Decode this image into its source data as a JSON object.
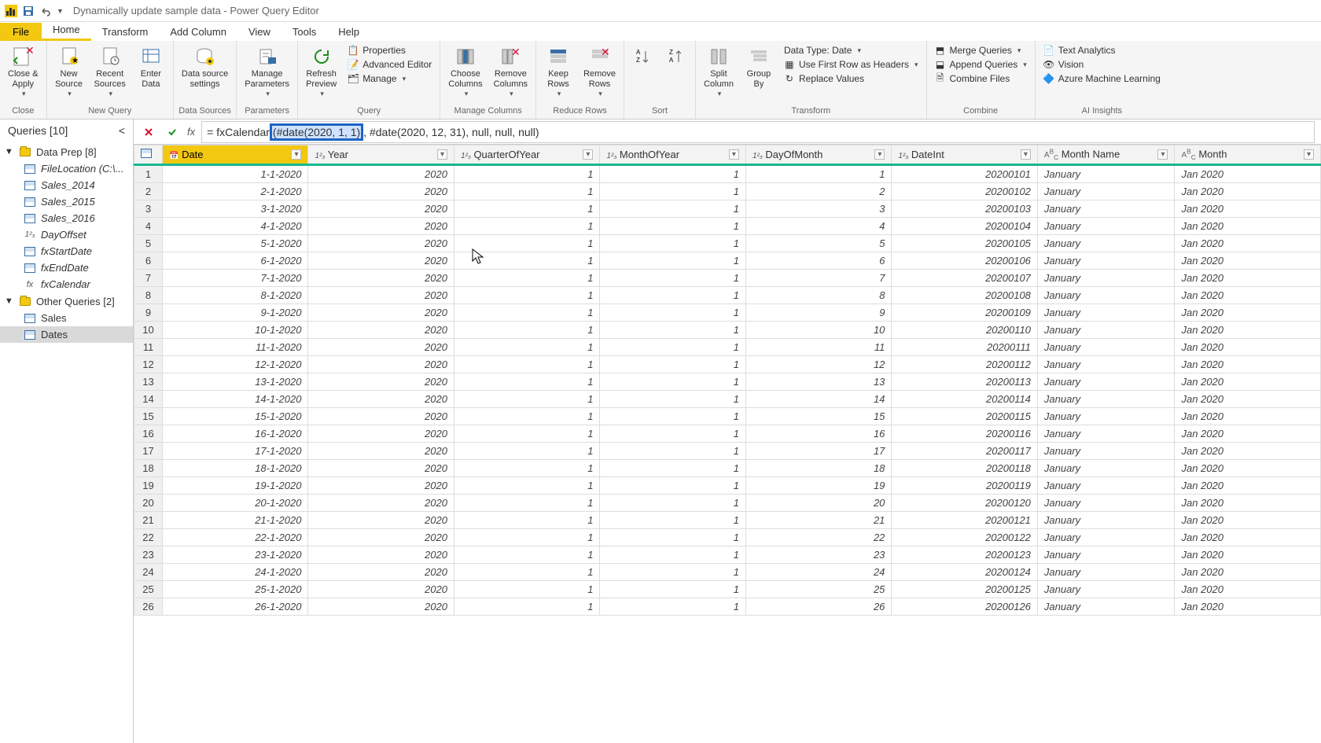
{
  "title": "Dynamically update sample data - Power Query Editor",
  "menu": {
    "file": "File",
    "home": "Home",
    "transform": "Transform",
    "addcol": "Add Column",
    "view": "View",
    "tools": "Tools",
    "help": "Help"
  },
  "ribbon": {
    "close": {
      "closeapply": "Close &\nApply",
      "group": "Close"
    },
    "newquery": {
      "newsource": "New\nSource",
      "recentsources": "Recent\nSources",
      "enterdata": "Enter\nData",
      "group": "New Query"
    },
    "datasources": {
      "dsettings": "Data source\nsettings",
      "group": "Data Sources"
    },
    "parameters": {
      "manageparams": "Manage\nParameters",
      "group": "Parameters"
    },
    "query": {
      "refresh": "Refresh\nPreview",
      "properties": "Properties",
      "adveditor": "Advanced Editor",
      "manage": "Manage",
      "group": "Query"
    },
    "managecols": {
      "choose": "Choose\nColumns",
      "remove": "Remove\nColumns",
      "group": "Manage Columns"
    },
    "reducerows": {
      "keep": "Keep\nRows",
      "removerows": "Remove\nRows",
      "group": "Reduce Rows"
    },
    "sort": {
      "group": "Sort"
    },
    "transform": {
      "split": "Split\nColumn",
      "groupby": "Group\nBy",
      "datatype": "Data Type: Date",
      "firstrow": "Use First Row as Headers",
      "replace": "Replace Values",
      "group": "Transform"
    },
    "combine": {
      "merge": "Merge Queries",
      "append": "Append Queries",
      "combinefiles": "Combine Files",
      "group": "Combine"
    },
    "ai": {
      "text": "Text Analytics",
      "vision": "Vision",
      "azureml": "Azure Machine Learning",
      "group": "AI Insights"
    }
  },
  "queries": {
    "header": "Queries [10]",
    "groups": [
      {
        "name": "Data Prep [8]",
        "items": [
          {
            "label": "FileLocation (C:\\...",
            "icon": "table"
          },
          {
            "label": "Sales_2014",
            "icon": "table"
          },
          {
            "label": "Sales_2015",
            "icon": "table"
          },
          {
            "label": "Sales_2016",
            "icon": "table"
          },
          {
            "label": "DayOffset",
            "icon": "num"
          },
          {
            "label": "fxStartDate",
            "icon": "table"
          },
          {
            "label": "fxEndDate",
            "icon": "table"
          },
          {
            "label": "fxCalendar",
            "icon": "fx"
          }
        ]
      },
      {
        "name": "Other Queries [2]",
        "items": [
          {
            "label": "Sales",
            "icon": "table"
          },
          {
            "label": "Dates",
            "icon": "table",
            "selected": true
          }
        ]
      }
    ]
  },
  "formula": {
    "prefix": "= fxCalendar",
    "highlight": "(#date(2020, 1, 1)",
    "rest": ", #date(2020, 12, 31), null, null, null)"
  },
  "columns": [
    {
      "name": "Date",
      "type": "date",
      "selected": true,
      "align": "r"
    },
    {
      "name": "Year",
      "type": "num",
      "align": "r"
    },
    {
      "name": "QuarterOfYear",
      "type": "num",
      "align": "r"
    },
    {
      "name": "MonthOfYear",
      "type": "num",
      "align": "r"
    },
    {
      "name": "DayOfMonth",
      "type": "num",
      "align": "r"
    },
    {
      "name": "DateInt",
      "type": "num",
      "align": "r"
    },
    {
      "name": "Month Name",
      "type": "text",
      "align": "l"
    },
    {
      "name": "Month",
      "type": "text",
      "align": "l"
    }
  ],
  "rows": [
    [
      "1-1-2020",
      "2020",
      "1",
      "1",
      "1",
      "20200101",
      "January",
      "Jan 2020"
    ],
    [
      "2-1-2020",
      "2020",
      "1",
      "1",
      "2",
      "20200102",
      "January",
      "Jan 2020"
    ],
    [
      "3-1-2020",
      "2020",
      "1",
      "1",
      "3",
      "20200103",
      "January",
      "Jan 2020"
    ],
    [
      "4-1-2020",
      "2020",
      "1",
      "1",
      "4",
      "20200104",
      "January",
      "Jan 2020"
    ],
    [
      "5-1-2020",
      "2020",
      "1",
      "1",
      "5",
      "20200105",
      "January",
      "Jan 2020"
    ],
    [
      "6-1-2020",
      "2020",
      "1",
      "1",
      "6",
      "20200106",
      "January",
      "Jan 2020"
    ],
    [
      "7-1-2020",
      "2020",
      "1",
      "1",
      "7",
      "20200107",
      "January",
      "Jan 2020"
    ],
    [
      "8-1-2020",
      "2020",
      "1",
      "1",
      "8",
      "20200108",
      "January",
      "Jan 2020"
    ],
    [
      "9-1-2020",
      "2020",
      "1",
      "1",
      "9",
      "20200109",
      "January",
      "Jan 2020"
    ],
    [
      "10-1-2020",
      "2020",
      "1",
      "1",
      "10",
      "20200110",
      "January",
      "Jan 2020"
    ],
    [
      "11-1-2020",
      "2020",
      "1",
      "1",
      "11",
      "20200111",
      "January",
      "Jan 2020"
    ],
    [
      "12-1-2020",
      "2020",
      "1",
      "1",
      "12",
      "20200112",
      "January",
      "Jan 2020"
    ],
    [
      "13-1-2020",
      "2020",
      "1",
      "1",
      "13",
      "20200113",
      "January",
      "Jan 2020"
    ],
    [
      "14-1-2020",
      "2020",
      "1",
      "1",
      "14",
      "20200114",
      "January",
      "Jan 2020"
    ],
    [
      "15-1-2020",
      "2020",
      "1",
      "1",
      "15",
      "20200115",
      "January",
      "Jan 2020"
    ],
    [
      "16-1-2020",
      "2020",
      "1",
      "1",
      "16",
      "20200116",
      "January",
      "Jan 2020"
    ],
    [
      "17-1-2020",
      "2020",
      "1",
      "1",
      "17",
      "20200117",
      "January",
      "Jan 2020"
    ],
    [
      "18-1-2020",
      "2020",
      "1",
      "1",
      "18",
      "20200118",
      "January",
      "Jan 2020"
    ],
    [
      "19-1-2020",
      "2020",
      "1",
      "1",
      "19",
      "20200119",
      "January",
      "Jan 2020"
    ],
    [
      "20-1-2020",
      "2020",
      "1",
      "1",
      "20",
      "20200120",
      "January",
      "Jan 2020"
    ],
    [
      "21-1-2020",
      "2020",
      "1",
      "1",
      "21",
      "20200121",
      "January",
      "Jan 2020"
    ],
    [
      "22-1-2020",
      "2020",
      "1",
      "1",
      "22",
      "20200122",
      "January",
      "Jan 2020"
    ],
    [
      "23-1-2020",
      "2020",
      "1",
      "1",
      "23",
      "20200123",
      "January",
      "Jan 2020"
    ],
    [
      "24-1-2020",
      "2020",
      "1",
      "1",
      "24",
      "20200124",
      "January",
      "Jan 2020"
    ],
    [
      "25-1-2020",
      "2020",
      "1",
      "1",
      "25",
      "20200125",
      "January",
      "Jan 2020"
    ],
    [
      "26-1-2020",
      "2020",
      "1",
      "1",
      "26",
      "20200126",
      "January",
      "Jan 2020"
    ]
  ]
}
